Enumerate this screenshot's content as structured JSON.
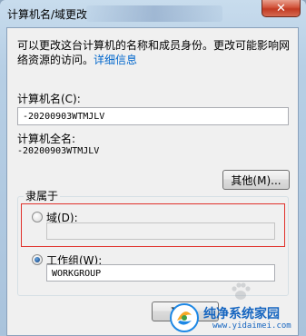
{
  "window": {
    "title": "计算机名/域更改",
    "close_symbol": "✕"
  },
  "description": {
    "text": "可以更改这台计算机的名称和成员身份。更改可能影响网络资源的访问。",
    "link": "详细信息"
  },
  "computer_name": {
    "label": "计算机名(C):",
    "value": "-20200903WTMJLV"
  },
  "full_name": {
    "label": "计算机全名:",
    "value": "-20200903WTMJLV"
  },
  "other_button": "其他(M)...",
  "member_of": {
    "title": "隶属于",
    "domain_label": "域(D):",
    "domain_value": "",
    "domain_checked": false,
    "workgroup_label": "工作组(W):",
    "workgroup_value": "WORKGROUP",
    "workgroup_checked": true
  },
  "buttons": {
    "ok_partial": "确"
  },
  "watermark": {
    "name": "纯净系统家园",
    "url": "www.yidaimei.com"
  },
  "colors": {
    "highlight_border": "#e0312b",
    "link": "#0066cc",
    "watermark": "#1565c0"
  }
}
